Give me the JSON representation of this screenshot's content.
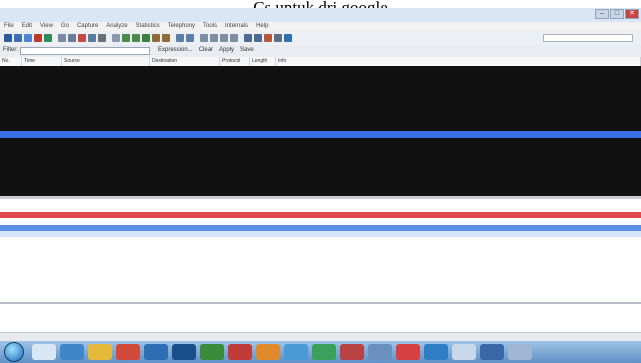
{
  "caption": "Cs untuk dri google",
  "window": {
    "title": "",
    "controls": [
      "–",
      "□",
      "✕"
    ]
  },
  "menu": [
    "File",
    "Edit",
    "View",
    "Go",
    "Capture",
    "Analyze",
    "Statistics",
    "Telephony",
    "Tools",
    "Internals",
    "Help"
  ],
  "filter": {
    "label": "Filter:",
    "actions": [
      "Expression...",
      "Clear",
      "Apply",
      "Save"
    ]
  },
  "columns": [
    "No.",
    "Time",
    "Source",
    "Destination",
    "Protocol",
    "Length",
    "Info"
  ],
  "packets": [],
  "colors": {
    "packet_row_bg": "#111111",
    "packet_row_text": "#f08a8a",
    "selected_row": "#3a6ee8",
    "error_row": "#e04a4a",
    "detail_highlight": "#d7e4f7"
  }
}
